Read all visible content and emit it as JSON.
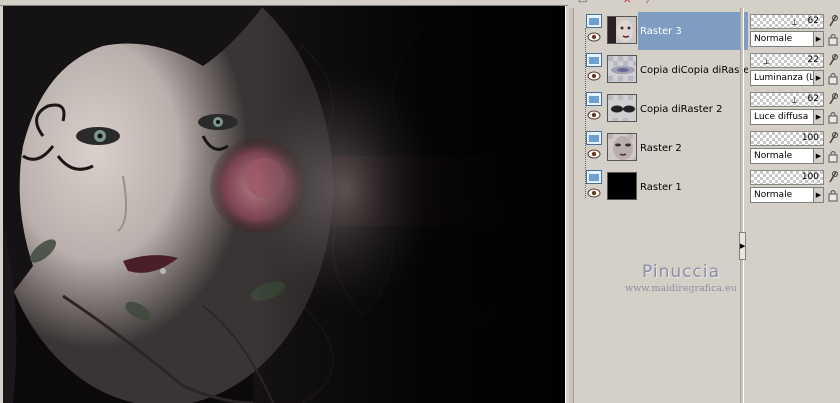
{
  "canvas": {
    "description_icon": "artwork-canvas"
  },
  "layers": [
    {
      "name": "Raster 3",
      "opacity": "62",
      "blend": "Normale",
      "selected": true,
      "thumb": "face-small"
    },
    {
      "name": "Copia diCopia diRaster",
      "opacity": "22",
      "blend": "Luminanza (L)",
      "selected": false,
      "thumb": "blurred-eyes"
    },
    {
      "name": "Copia diRaster 2",
      "opacity": "62",
      "blend": "Luce diffusa",
      "selected": false,
      "thumb": "dark-eyes"
    },
    {
      "name": "Raster 2",
      "opacity": "100",
      "blend": "Normale",
      "selected": false,
      "thumb": "face-crop"
    },
    {
      "name": "Raster 1",
      "opacity": "100",
      "blend": "Normale",
      "selected": false,
      "thumb": "black-fill"
    }
  ],
  "watermark": {
    "name": "Pinuccia",
    "url": "www.maidiregrafica.eu"
  },
  "colors": {
    "panel_bg": "#d4d0c8",
    "selection": "#7f9cc3",
    "watermark": "#8e8ea3"
  }
}
